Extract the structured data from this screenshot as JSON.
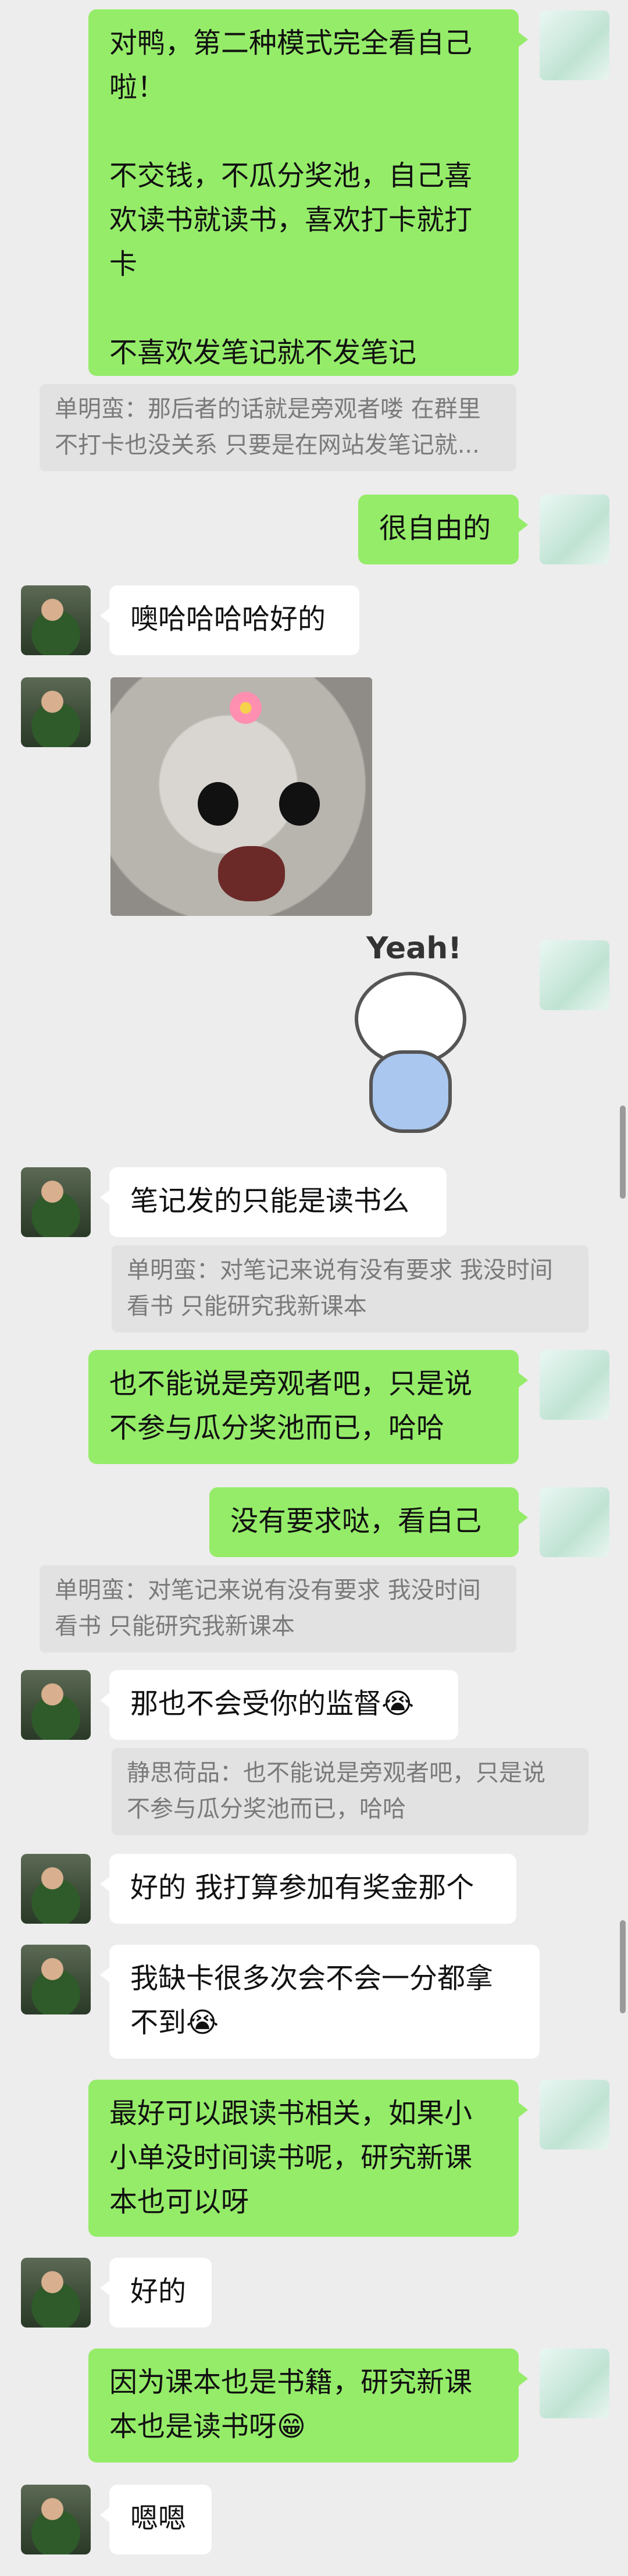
{
  "messages": {
    "m1": "对鸭，第二种模式完全看自己\n啦！\n\n不交钱，不瓜分奖池，自己喜\n欢读书就读书，喜欢打卡就打\n卡\n\n不喜欢发笔记就不发笔记",
    "q1": "单明蛮：那后者的话就是旁观者喽 在群里\n不打卡也没关系 只要是在网站发笔记就...",
    "m2": "很自由的",
    "t1": "噢哈哈哈哈好的",
    "sticker_text": "Yeah!",
    "t2": "笔记发的只能是读书么",
    "q2": "单明蛮：对笔记来说有没有要求 我没时间\n看书 只能研究我新课本",
    "m3": "也不能说是旁观者吧，只是说\n不参与瓜分奖池而已，哈哈",
    "m4": "没有要求哒，看自己",
    "q3": "单明蛮：对笔记来说有没有要求 我没时间\n看书 只能研究我新课本",
    "t3": "那也不会受你的监督😭",
    "q4": "静思荷品：也不能说是旁观者吧，只是说\n不参与瓜分奖池而已，哈哈",
    "t4": "好的 我打算参加有奖金那个",
    "t5": "我缺卡很多次会不会一分都拿\n不到😭",
    "m5": "最好可以跟读书相关，如果小\n小单没时间读书呢，研究新课\n本也可以呀",
    "t6": "好的",
    "m6": "因为课本也是书籍，研究新课\n本也是读书呀😁",
    "t7": "嗯嗯"
  }
}
